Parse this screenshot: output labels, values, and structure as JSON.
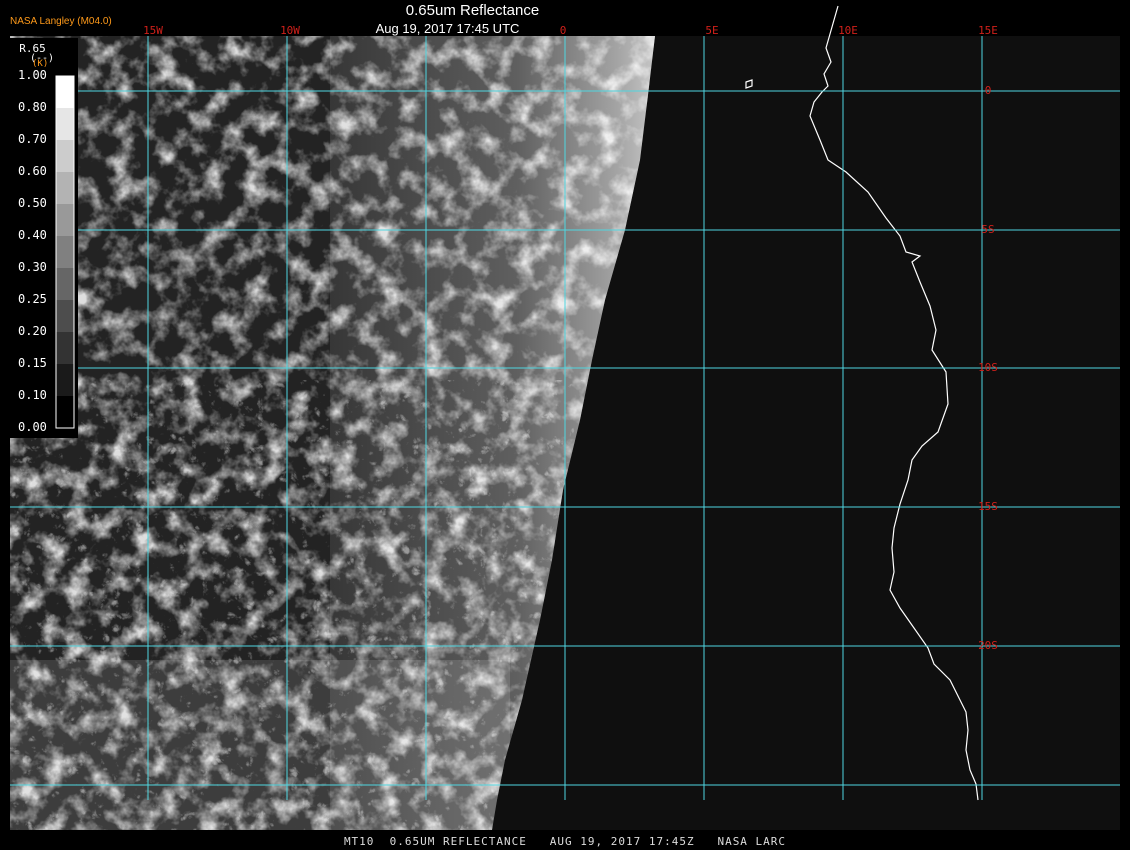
{
  "header": {
    "org": "NASA Langley (M04.0)",
    "title": "0.65um Reflectance",
    "datetime": "Aug 19, 2017 17:45 UTC"
  },
  "footer": {
    "text": "MT10  0.65UM REFLECTANCE   AUG 19, 2017 17:45Z   NASA LARC"
  },
  "colorbar": {
    "title": "R.65",
    "unit": "(--)",
    "unit_prefix": "(K)",
    "ticks": [
      "1.00",
      "0.80",
      "0.70",
      "0.60",
      "0.50",
      "0.40",
      "0.30",
      "0.25",
      "0.20",
      "0.15",
      "0.10",
      "0.00"
    ]
  },
  "map": {
    "lon_labels": [
      "15W",
      "10W",
      "0",
      "5E",
      "10E",
      "15E"
    ],
    "lat_labels": [
      "0",
      "5S",
      "10S",
      "15S",
      "20S"
    ],
    "grid_color": "#4fd6e0",
    "label_color": "#d0201a",
    "coast_color": "#ffffff"
  }
}
